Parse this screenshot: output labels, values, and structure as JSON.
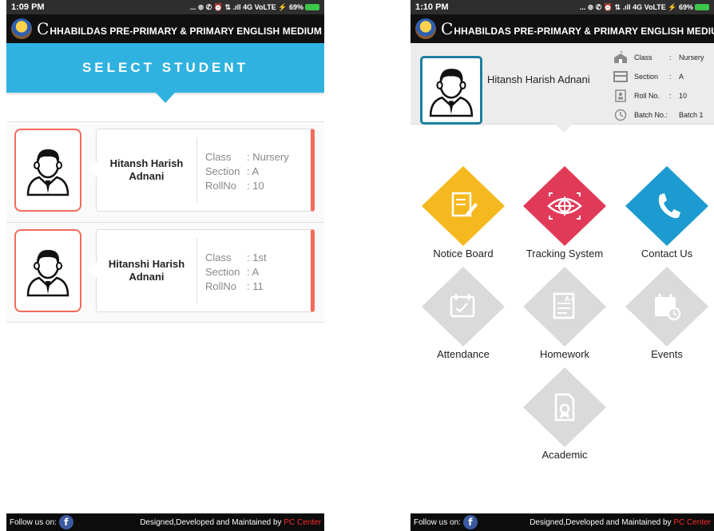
{
  "left": {
    "status": {
      "time": "1:09 PM",
      "right": "... ⊚ ✆ ⏰ ⇅ .ıll 4G VoLTE ⚡ 69%"
    },
    "header": {
      "school_initial": "C",
      "school_rest": "HHABILDAS PRE-PRIMARY & PRIMARY ENGLISH MEDIUM SCHOOL"
    },
    "banner": "SELECT STUDENT",
    "students": [
      {
        "name": "Hitansh Harish Adnani",
        "class_label": "Class",
        "class_value": ": Nursery",
        "section_label": "Section",
        "section_value": ": A",
        "roll_label": "RollNo",
        "roll_value": ": 10"
      },
      {
        "name": "Hitanshi Harish Adnani",
        "class_label": "Class",
        "class_value": ": 1st",
        "section_label": "Section",
        "section_value": ": A",
        "roll_label": "RollNo",
        "roll_value": ": 11"
      }
    ],
    "footer": {
      "follow": "Follow us on:",
      "credit": "Designed,Developed and Maintained by ",
      "credit_brand": "PC Center"
    }
  },
  "right": {
    "status": {
      "time": "1:10 PM",
      "right": "... ⊚ ✆ ⏰ ⇅ .ıll 4G VoLTE ⚡ 69%"
    },
    "header": {
      "school_initial": "C",
      "school_rest": "HHABILDAS PRE-PRIMARY & PRIMARY ENGLISH MEDIUM SCHOOL"
    },
    "profile": {
      "name": "Hitansh Harish Adnani",
      "class_label": "Class",
      "class_value": "Nursery",
      "section_label": "Section",
      "section_value": "A",
      "roll_label": "Roll No.",
      "roll_value": "10",
      "batch_label": "Batch No.:",
      "batch_value": "Batch 1"
    },
    "menu": [
      {
        "label": "Notice Board",
        "icon": "notice-board-icon",
        "color": "#f5b91f"
      },
      {
        "label": "Tracking System",
        "icon": "tracking-eye-icon",
        "color": "#e13a58"
      },
      {
        "label": "Contact Us",
        "icon": "phone-icon",
        "color": "#1c9bd0"
      },
      {
        "label": "Attendance",
        "icon": "attendance-icon",
        "color": "#dadada"
      },
      {
        "label": "Homework",
        "icon": "homework-icon",
        "color": "#dadada"
      },
      {
        "label": "Events",
        "icon": "events-calendar-icon",
        "color": "#dadada"
      },
      {
        "label": "Academic",
        "icon": "academic-certificate-icon",
        "color": "#dadada"
      }
    ],
    "footer": {
      "follow": "Follow us on:",
      "credit": "Designed,Developed and Maintained by ",
      "credit_brand": "PC Center"
    }
  },
  "colors": {
    "accent_blue": "#2fb2e0",
    "card_accent": "#f26b5b",
    "brand_red": "#ff2a2a"
  }
}
